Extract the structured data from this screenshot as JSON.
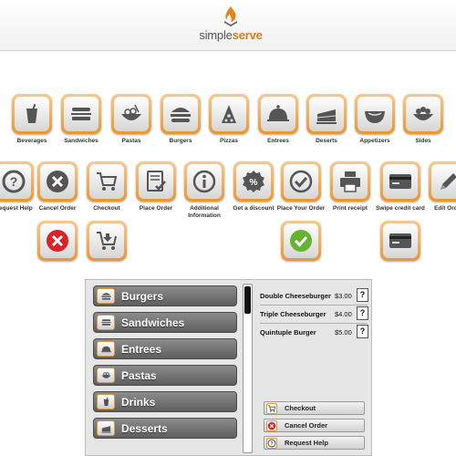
{
  "header": {
    "brand_light": "simple",
    "brand_bold": "serve"
  },
  "menu_categories": [
    {
      "label": "Beverages",
      "icon": "glass-icon"
    },
    {
      "label": "Sandwiches",
      "icon": "sandwich-icon"
    },
    {
      "label": "Pastas",
      "icon": "pasta-bowl-icon"
    },
    {
      "label": "Burgers",
      "icon": "burger-icon"
    },
    {
      "label": "Pizzas",
      "icon": "pizza-slice-icon"
    },
    {
      "label": "Entrees",
      "icon": "cloche-icon"
    },
    {
      "label": "Deserts",
      "icon": "cake-icon"
    },
    {
      "label": "Appetizers",
      "icon": "bowl-icon"
    },
    {
      "label": "Sides",
      "icon": "side-dish-icon"
    }
  ],
  "actions": [
    {
      "label": "Request Help",
      "icon": "question-icon"
    },
    {
      "label": "Cancel Order",
      "icon": "x-circle-icon"
    },
    {
      "label": "Checkout",
      "icon": "cart-icon"
    },
    {
      "label": "Place Order",
      "icon": "checklist-icon"
    },
    {
      "label": "Additional Information",
      "icon": "info-icon"
    },
    {
      "label": "Get a discount",
      "icon": "percent-icon"
    },
    {
      "label": "Place Your Order",
      "icon": "check-circle-icon"
    },
    {
      "label": "Print receipt",
      "icon": "printer-icon"
    },
    {
      "label": "Swipe credit card",
      "icon": "credit-card-icon"
    },
    {
      "label": "Edit Order",
      "icon": "pencil-icon"
    }
  ],
  "alt_icons": [
    {
      "icon": "red-x-icon"
    },
    {
      "icon": "cart-download-icon"
    },
    {
      "icon": "green-check-icon"
    },
    {
      "icon": "card-icon"
    }
  ],
  "panel": {
    "categories": [
      "Burgers",
      "Sandwiches",
      "Entrees",
      "Pastas",
      "Drinks",
      "Desserts"
    ],
    "order_items": [
      {
        "name": "Double Cheeseburger",
        "price": "$3.00",
        "q": "?"
      },
      {
        "name": "Triple Cheeseburger",
        "price": "$4.00",
        "q": "?"
      },
      {
        "name": "Quintuple Burger",
        "price": "$5.00",
        "q": "?"
      }
    ],
    "buttons": [
      "Checkout",
      "Cancel Order",
      "Request Help"
    ]
  },
  "colors": {
    "accent": "#e8982f",
    "panel_button": "#6f6f6f",
    "success": "#66b32e",
    "danger": "#d8232a"
  }
}
